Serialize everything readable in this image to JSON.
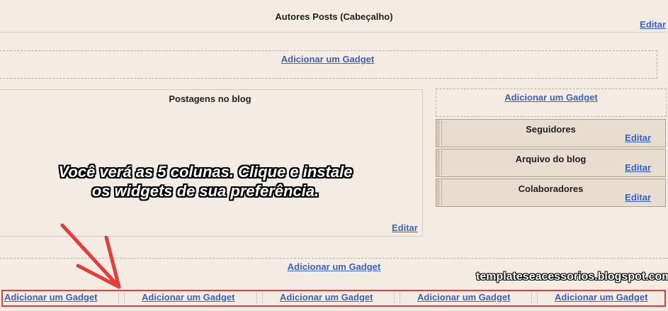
{
  "header": {
    "title": "Autores Posts (Cabeçalho)",
    "edit_label": "Editar"
  },
  "top_add_gadget": "Adicionar um Gadget",
  "main": {
    "title": "Postagens no blog",
    "edit_label": "Editar"
  },
  "sidebar": {
    "add_gadget": "Adicionar um Gadget",
    "gadgets": [
      {
        "title": "Seguidores",
        "edit_label": "Editar"
      },
      {
        "title": "Arquivo do blog",
        "edit_label": "Editar"
      },
      {
        "title": "Colaboradores",
        "edit_label": "Editar"
      }
    ]
  },
  "overlay": {
    "line1": "Você verá as 5 colunas. Clique e instale",
    "line2": "os widgets de sua preferência."
  },
  "bottom_add_gadget": "Adicionar um Gadget",
  "watermark": "templateseacessorios.blogspot.com",
  "footer_columns": [
    "Adicionar um Gadget",
    "Adicionar um Gadget",
    "Adicionar um Gadget",
    "Adicionar um Gadget",
    "Adicionar um Gadget"
  ],
  "colors": {
    "link": "#3b63c4",
    "background": "#f4ece3",
    "highlight": "#e53b3b"
  }
}
